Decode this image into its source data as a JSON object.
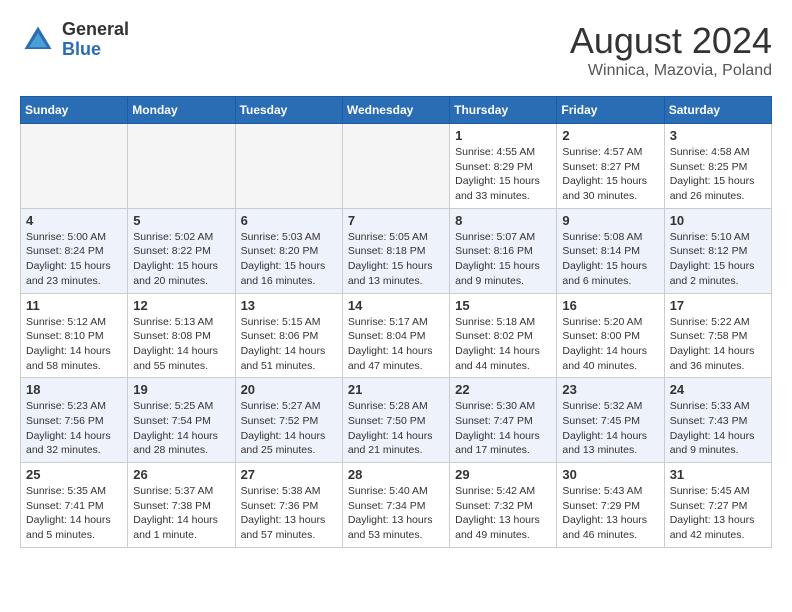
{
  "header": {
    "logo_general": "General",
    "logo_blue": "Blue",
    "month_year": "August 2024",
    "location": "Winnica, Mazovia, Poland"
  },
  "weekdays": [
    "Sunday",
    "Monday",
    "Tuesday",
    "Wednesday",
    "Thursday",
    "Friday",
    "Saturday"
  ],
  "weeks": [
    [
      {
        "day": "",
        "empty": true
      },
      {
        "day": "",
        "empty": true
      },
      {
        "day": "",
        "empty": true
      },
      {
        "day": "",
        "empty": true
      },
      {
        "day": "1",
        "sunrise": "4:55 AM",
        "sunset": "8:29 PM",
        "daylight": "15 hours and 33 minutes."
      },
      {
        "day": "2",
        "sunrise": "4:57 AM",
        "sunset": "8:27 PM",
        "daylight": "15 hours and 30 minutes."
      },
      {
        "day": "3",
        "sunrise": "4:58 AM",
        "sunset": "8:25 PM",
        "daylight": "15 hours and 26 minutes."
      }
    ],
    [
      {
        "day": "4",
        "sunrise": "5:00 AM",
        "sunset": "8:24 PM",
        "daylight": "15 hours and 23 minutes."
      },
      {
        "day": "5",
        "sunrise": "5:02 AM",
        "sunset": "8:22 PM",
        "daylight": "15 hours and 20 minutes."
      },
      {
        "day": "6",
        "sunrise": "5:03 AM",
        "sunset": "8:20 PM",
        "daylight": "15 hours and 16 minutes."
      },
      {
        "day": "7",
        "sunrise": "5:05 AM",
        "sunset": "8:18 PM",
        "daylight": "15 hours and 13 minutes."
      },
      {
        "day": "8",
        "sunrise": "5:07 AM",
        "sunset": "8:16 PM",
        "daylight": "15 hours and 9 minutes."
      },
      {
        "day": "9",
        "sunrise": "5:08 AM",
        "sunset": "8:14 PM",
        "daylight": "15 hours and 6 minutes."
      },
      {
        "day": "10",
        "sunrise": "5:10 AM",
        "sunset": "8:12 PM",
        "daylight": "15 hours and 2 minutes."
      }
    ],
    [
      {
        "day": "11",
        "sunrise": "5:12 AM",
        "sunset": "8:10 PM",
        "daylight": "14 hours and 58 minutes."
      },
      {
        "day": "12",
        "sunrise": "5:13 AM",
        "sunset": "8:08 PM",
        "daylight": "14 hours and 55 minutes."
      },
      {
        "day": "13",
        "sunrise": "5:15 AM",
        "sunset": "8:06 PM",
        "daylight": "14 hours and 51 minutes."
      },
      {
        "day": "14",
        "sunrise": "5:17 AM",
        "sunset": "8:04 PM",
        "daylight": "14 hours and 47 minutes."
      },
      {
        "day": "15",
        "sunrise": "5:18 AM",
        "sunset": "8:02 PM",
        "daylight": "14 hours and 44 minutes."
      },
      {
        "day": "16",
        "sunrise": "5:20 AM",
        "sunset": "8:00 PM",
        "daylight": "14 hours and 40 minutes."
      },
      {
        "day": "17",
        "sunrise": "5:22 AM",
        "sunset": "7:58 PM",
        "daylight": "14 hours and 36 minutes."
      }
    ],
    [
      {
        "day": "18",
        "sunrise": "5:23 AM",
        "sunset": "7:56 PM",
        "daylight": "14 hours and 32 minutes."
      },
      {
        "day": "19",
        "sunrise": "5:25 AM",
        "sunset": "7:54 PM",
        "daylight": "14 hours and 28 minutes."
      },
      {
        "day": "20",
        "sunrise": "5:27 AM",
        "sunset": "7:52 PM",
        "daylight": "14 hours and 25 minutes."
      },
      {
        "day": "21",
        "sunrise": "5:28 AM",
        "sunset": "7:50 PM",
        "daylight": "14 hours and 21 minutes."
      },
      {
        "day": "22",
        "sunrise": "5:30 AM",
        "sunset": "7:47 PM",
        "daylight": "14 hours and 17 minutes."
      },
      {
        "day": "23",
        "sunrise": "5:32 AM",
        "sunset": "7:45 PM",
        "daylight": "14 hours and 13 minutes."
      },
      {
        "day": "24",
        "sunrise": "5:33 AM",
        "sunset": "7:43 PM",
        "daylight": "14 hours and 9 minutes."
      }
    ],
    [
      {
        "day": "25",
        "sunrise": "5:35 AM",
        "sunset": "7:41 PM",
        "daylight": "14 hours and 5 minutes."
      },
      {
        "day": "26",
        "sunrise": "5:37 AM",
        "sunset": "7:38 PM",
        "daylight": "14 hours and 1 minute."
      },
      {
        "day": "27",
        "sunrise": "5:38 AM",
        "sunset": "7:36 PM",
        "daylight": "13 hours and 57 minutes."
      },
      {
        "day": "28",
        "sunrise": "5:40 AM",
        "sunset": "7:34 PM",
        "daylight": "13 hours and 53 minutes."
      },
      {
        "day": "29",
        "sunrise": "5:42 AM",
        "sunset": "7:32 PM",
        "daylight": "13 hours and 49 minutes."
      },
      {
        "day": "30",
        "sunrise": "5:43 AM",
        "sunset": "7:29 PM",
        "daylight": "13 hours and 46 minutes."
      },
      {
        "day": "31",
        "sunrise": "5:45 AM",
        "sunset": "7:27 PM",
        "daylight": "13 hours and 42 minutes."
      }
    ]
  ]
}
